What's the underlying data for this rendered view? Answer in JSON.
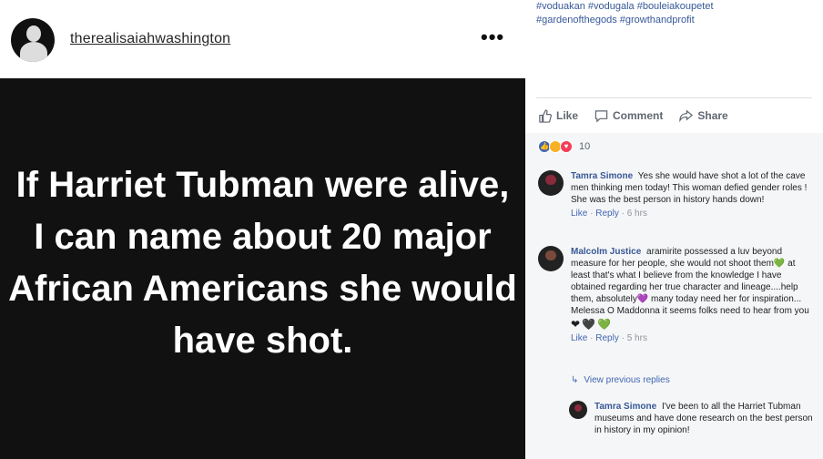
{
  "instagram": {
    "username": "therealisaiahwashington",
    "more_icon": "•••",
    "quote": "If Harriet Tubman were alive, I can name about 20 major African Americans she would have shot."
  },
  "facebook": {
    "hashtags_line1": "#voduakan #vodugala #bouleiakoupetet",
    "hashtags_line2": "#gardenofthegods #growthandprofit",
    "actions": {
      "like": "Like",
      "comment": "Comment",
      "share": "Share"
    },
    "reaction_count": "10",
    "comments": [
      {
        "name": "Tamra Simone",
        "text": "Yes she would have shot a lot of the cave men thinking men today! This woman defied gender roles ! She was the best person in history hands down!",
        "like": "Like",
        "reply": "Reply",
        "time": "6 hrs"
      },
      {
        "name": "Malcolm Justice",
        "text": "aramirite possessed a luv beyond measure for her people, she would not shoot them💚 at least that's what I believe from the knowledge I have obtained regarding her true character and lineage....help them, absolutely💜 many today need her for inspiration... Melessa O Maddonna it seems folks need to hear from you",
        "hearts": "❤🖤💚",
        "like": "Like",
        "reply": "Reply",
        "time": "5 hrs"
      }
    ],
    "view_replies": "View previous replies",
    "reply": {
      "name": "Tamra Simone",
      "text": "I've been to all the Harriet Tubman museums and have done research on the best person in history in my opinion!"
    }
  }
}
